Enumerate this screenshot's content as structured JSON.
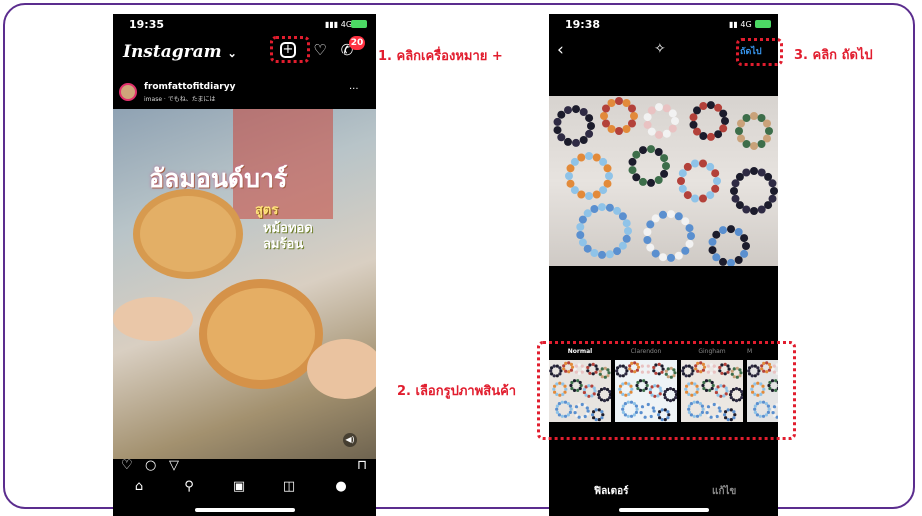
{
  "phone_left": {
    "status_time": "19:35",
    "signal_text": "4G",
    "app_logo": "Instagram",
    "logo_caret": "⌄",
    "new_post_icon": "plus-square-icon",
    "notification_count": "20",
    "post": {
      "username": "fromfattofitdiaryy",
      "subtitle": "imase · でもね、たまには",
      "more": "···",
      "image_text": {
        "title": "อัลมอนด์บาร์",
        "line1": "สูตร",
        "line2": "หม้อทอด",
        "line3": "ลมร้อน"
      }
    }
  },
  "phone_right": {
    "status_time": "19:38",
    "signal_text": "4G",
    "back_icon": "chevron-left-icon",
    "magic_icon": "magic-wand-icon",
    "next_label": "ถัดไป",
    "filters": [
      {
        "name": "Normal",
        "active": true
      },
      {
        "name": "Clarendon",
        "active": false
      },
      {
        "name": "Gingham",
        "active": false
      },
      {
        "name": "M",
        "active": false
      }
    ],
    "tabs": {
      "filter": "ฟิลเตอร์",
      "edit": "แก้ไข"
    }
  },
  "annotations": {
    "step1": "1. คลิกเครื่องหมาย +",
    "step2": "2. เลือกรูปภาพสินค้า",
    "step3": "3. คลิก ถัดไป"
  },
  "colors": {
    "frame": "#5b2d8e",
    "annotation": "#e11d2e",
    "accent_blue": "#3897f0",
    "badge": "#ff3040"
  }
}
